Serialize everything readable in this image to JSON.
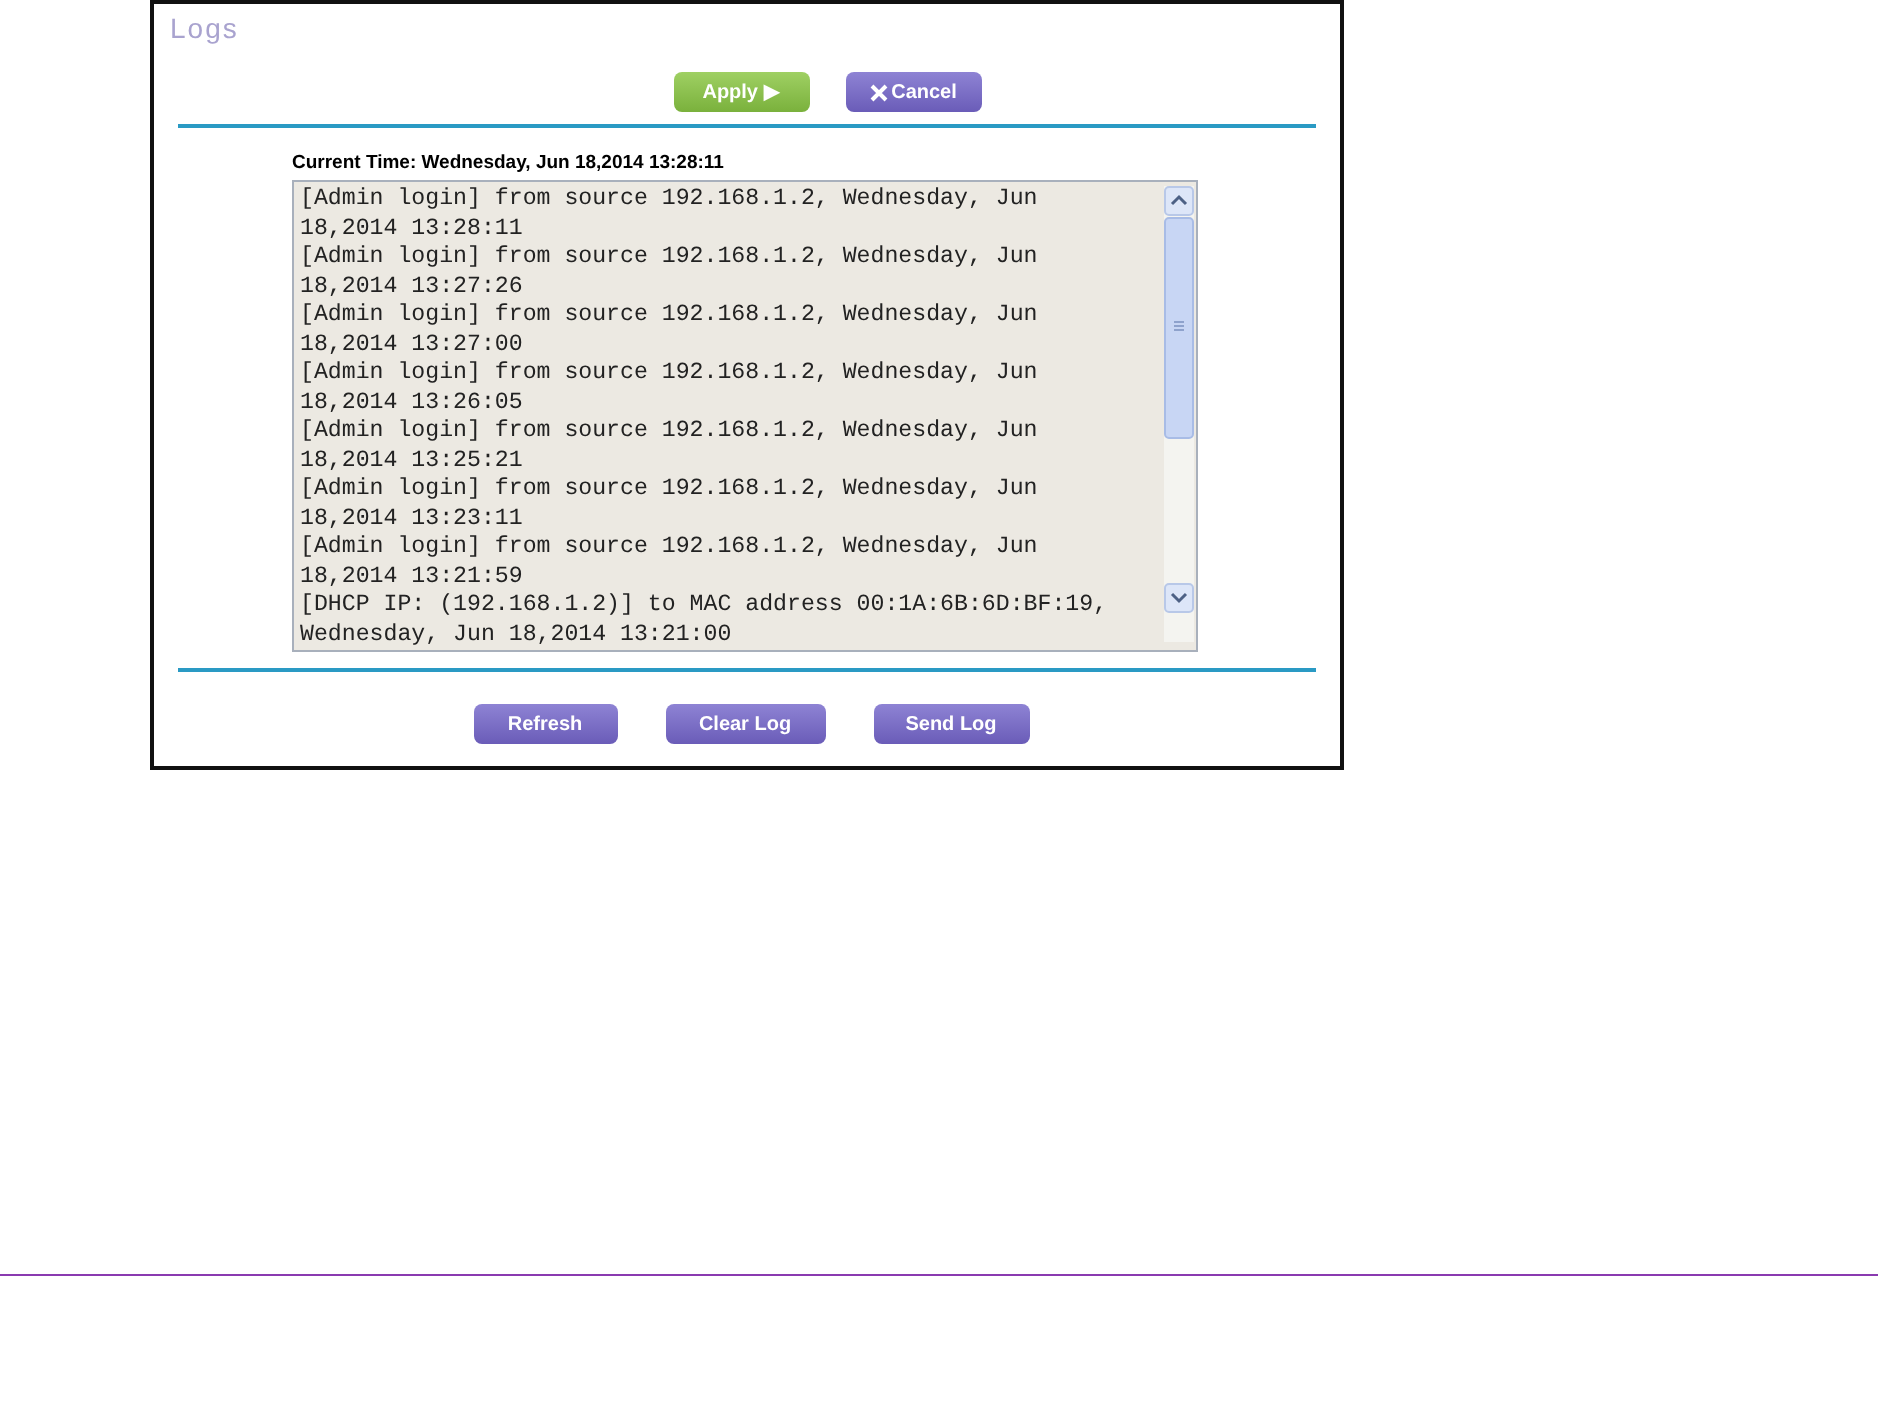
{
  "panel": {
    "title": "Logs"
  },
  "top_buttons": [
    {
      "label": "Apply ▶",
      "kind": "apply"
    },
    {
      "label": "Cancel",
      "kind": "cancel"
    }
  ],
  "current_time": "Current Time: Wednesday, Jun 18,2014 13:28:11",
  "log_lines": [
    "[Admin login] from source 192.168.1.2, Wednesday, Jun",
    "18,2014 13:28:11",
    "[Admin login] from source 192.168.1.2, Wednesday, Jun",
    "18,2014 13:27:26",
    "[Admin login] from source 192.168.1.2, Wednesday, Jun",
    "18,2014 13:27:00",
    "[Admin login] from source 192.168.1.2, Wednesday, Jun",
    "18,2014 13:26:05",
    "[Admin login] from source 192.168.1.2, Wednesday, Jun",
    "18,2014 13:25:21",
    "[Admin login] from source 192.168.1.2, Wednesday, Jun",
    "18,2014 13:23:11",
    "[Admin login] from source 192.168.1.2, Wednesday, Jun",
    "18,2014 13:21:59",
    "[DHCP IP: (192.168.1.2)] to MAC address 00:1A:6B:6D:BF:19,",
    "Wednesday, Jun 18,2014 13:21:00"
  ],
  "bottom_buttons": [
    "Refresh",
    "Clear Log",
    "Send Log"
  ]
}
